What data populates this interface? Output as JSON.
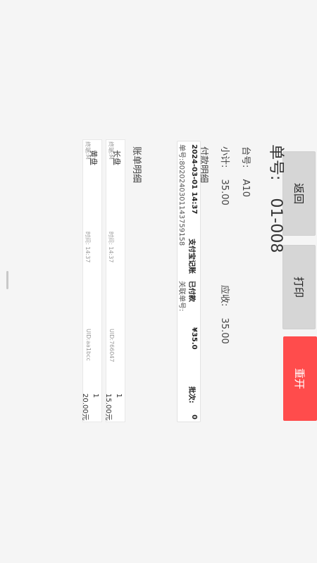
{
  "buttons": {
    "back": "返回",
    "print": "打印",
    "reopen": "重开"
  },
  "order": {
    "label": "单号:",
    "number": "01-008"
  },
  "table": {
    "label": "台号:",
    "value": "A10"
  },
  "subtotal": {
    "label": "小计:",
    "value": "35.00"
  },
  "receivable": {
    "label": "应收:",
    "value": "35.00"
  },
  "payment_section": "付款明细",
  "payment": {
    "datetime": "2024-03-01 14:37",
    "method": "支付宝记账",
    "status": "已付款",
    "amount": "¥35.0",
    "batch_label": "批次:",
    "batch_value": "0",
    "order_no": "单号:802024030114375915​8",
    "linked_label": "关联单号:"
  },
  "bill_section": "账单明细",
  "items": [
    {
      "name": "长盘",
      "staff": "终端:M",
      "time": "时间: 14:37",
      "uid": "UID:766047",
      "qty": "1",
      "amount": "15.00元"
    },
    {
      "name": "黄盘",
      "staff": "终端:M",
      "time": "时间: 14:37",
      "uid": "UID:aa1bcc",
      "qty": "1",
      "amount": "20.00元"
    }
  ],
  "colors": {
    "accent": "#ff4c4c",
    "button_gray": "#d6d6d6"
  }
}
